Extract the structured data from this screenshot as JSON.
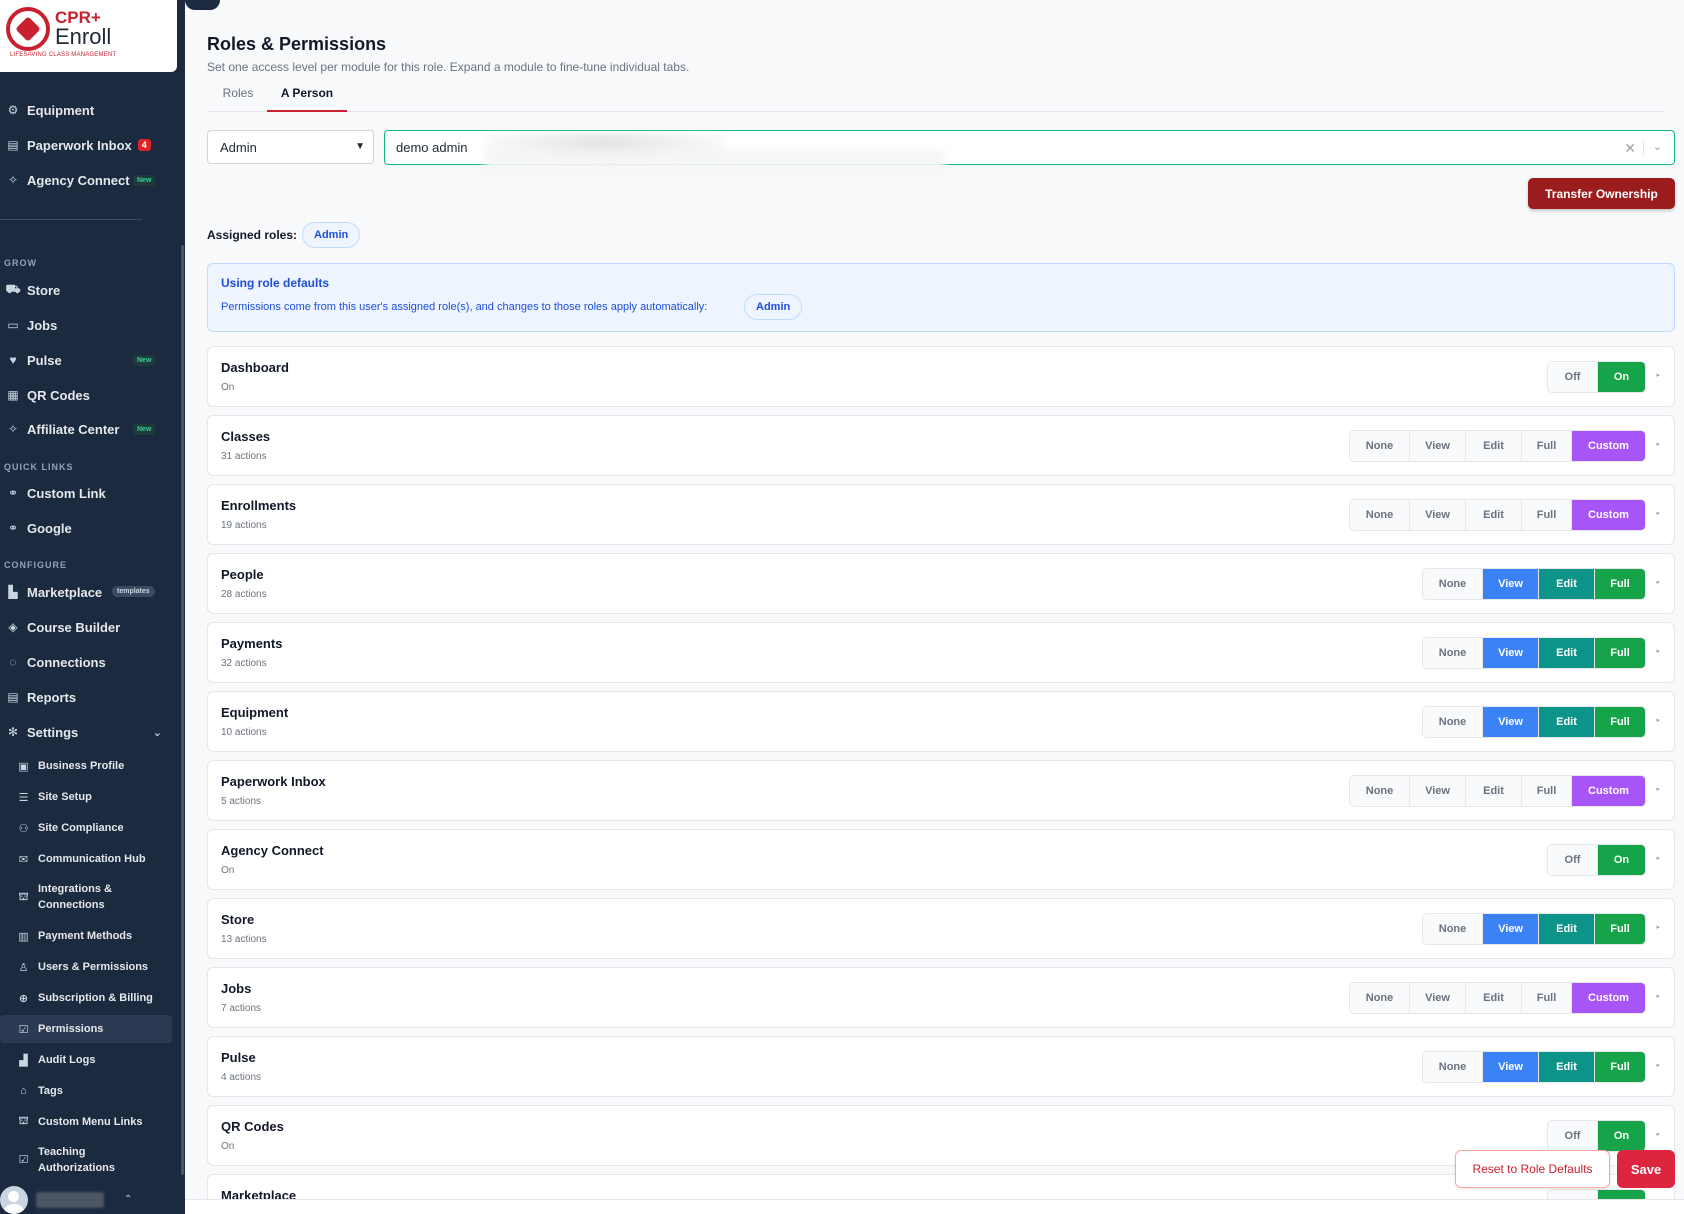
{
  "brand": {
    "name_top": "CPR+",
    "name_bottom": "Enroll",
    "tagline": "LIFESAVING CLASS MANAGEMENT",
    "primary_color": "#c8202f",
    "sidebar_color": "#1b2a3f"
  },
  "sidebar": {
    "top_items": [
      {
        "label": "Equipment",
        "icon": "equipment-icon"
      },
      {
        "label": "Paperwork Inbox",
        "icon": "inbox-icon",
        "badge": "4"
      },
      {
        "label": "Agency Connect",
        "icon": "handshake-icon",
        "badge_new": "New"
      }
    ],
    "sections": {
      "grow": "GROW",
      "quick_links": "QUICK LINKS",
      "configure": "CONFIGURE"
    },
    "grow_items": [
      {
        "label": "Store",
        "icon": "cart-icon"
      },
      {
        "label": "Jobs",
        "icon": "briefcase-icon"
      },
      {
        "label": "Pulse",
        "icon": "heart-icon",
        "badge_new": "New"
      },
      {
        "label": "QR Codes",
        "icon": "qr-icon"
      },
      {
        "label": "Affiliate Center",
        "icon": "handshake-icon",
        "badge_new": "New"
      }
    ],
    "quick_links": [
      {
        "label": "Custom Link",
        "icon": "link-icon"
      },
      {
        "label": "Google",
        "icon": "link-icon"
      }
    ],
    "configure_items": [
      {
        "label": "Marketplace",
        "icon": "store-icon",
        "badge_tpl": "templates"
      },
      {
        "label": "Course Builder",
        "icon": "graduation-icon"
      },
      {
        "label": "Connections",
        "icon": "plug-icon"
      },
      {
        "label": "Reports",
        "icon": "report-icon"
      },
      {
        "label": "Settings",
        "icon": "gear-icon"
      }
    ],
    "settings_items": [
      {
        "label": "Business Profile",
        "icon": "id-card-icon"
      },
      {
        "label": "Site Setup",
        "icon": "sliders-icon"
      },
      {
        "label": "Site Compliance",
        "icon": "users-icon"
      },
      {
        "label": "Communication Hub",
        "icon": "mail-icon"
      },
      {
        "label": "Integrations & Connections",
        "icon": "sitemap-icon"
      },
      {
        "label": "Payment Methods",
        "icon": "receipt-icon"
      },
      {
        "label": "Users & Permissions",
        "icon": "user-icon"
      },
      {
        "label": "Subscription & Billing",
        "icon": "search-dollar-icon"
      },
      {
        "label": "Permissions",
        "icon": "clipboard-check-icon",
        "active": true
      },
      {
        "label": "Audit Logs",
        "icon": "chart-icon"
      },
      {
        "label": "Tags",
        "icon": "tag-icon"
      },
      {
        "label": "Custom Menu Links",
        "icon": "sitemap-icon"
      },
      {
        "label": "Teaching Authorizations",
        "icon": "clipboard-check-icon"
      }
    ]
  },
  "header": {
    "title": "Roles & Permissions",
    "subtitle": "Set one access level per module for this role. Expand a module to fine-tune individual tabs."
  },
  "tabs": [
    {
      "label": "Roles",
      "active": false
    },
    {
      "label": "A Person",
      "active": true
    }
  ],
  "filters": {
    "role_value": "Admin",
    "person_value": "demo admin"
  },
  "actions": {
    "transfer_ownership": "Transfer Ownership",
    "reset": "Reset to Role Defaults",
    "save": "Save"
  },
  "assigned": {
    "label": "Assigned roles:",
    "roles": [
      "Admin"
    ]
  },
  "info": {
    "title": "Using role defaults",
    "text": "Permissions come from this user's assigned role(s), and changes to those roles apply automatically:",
    "role": "Admin"
  },
  "modules": [
    {
      "name": "Dashboard",
      "sub": "On",
      "type": "toggle",
      "options": [
        "Off",
        "On"
      ],
      "selected": "On"
    },
    {
      "name": "Classes",
      "sub": "31 actions",
      "type": "custom",
      "options": [
        "None",
        "View",
        "Edit",
        "Full",
        "Custom"
      ],
      "selected": "Custom"
    },
    {
      "name": "Enrollments",
      "sub": "19 actions",
      "type": "custom",
      "options": [
        "None",
        "View",
        "Edit",
        "Full",
        "Custom"
      ],
      "selected": "Custom"
    },
    {
      "name": "People",
      "sub": "28 actions",
      "type": "level",
      "options": [
        "None",
        "View",
        "Edit",
        "Full"
      ],
      "selected": "Full"
    },
    {
      "name": "Payments",
      "sub": "32 actions",
      "type": "level",
      "options": [
        "None",
        "View",
        "Edit",
        "Full"
      ],
      "selected": "Full"
    },
    {
      "name": "Equipment",
      "sub": "10 actions",
      "type": "level",
      "options": [
        "None",
        "View",
        "Edit",
        "Full"
      ],
      "selected": "Full"
    },
    {
      "name": "Paperwork Inbox",
      "sub": "5 actions",
      "type": "custom",
      "options": [
        "None",
        "View",
        "Edit",
        "Full",
        "Custom"
      ],
      "selected": "Custom"
    },
    {
      "name": "Agency Connect",
      "sub": "On",
      "type": "toggle",
      "options": [
        "Off",
        "On"
      ],
      "selected": "On"
    },
    {
      "name": "Store",
      "sub": "13 actions",
      "type": "level",
      "options": [
        "None",
        "View",
        "Edit",
        "Full"
      ],
      "selected": "Full"
    },
    {
      "name": "Jobs",
      "sub": "7 actions",
      "type": "custom",
      "options": [
        "None",
        "View",
        "Edit",
        "Full",
        "Custom"
      ],
      "selected": "Custom"
    },
    {
      "name": "Pulse",
      "sub": "4 actions",
      "type": "level",
      "options": [
        "None",
        "View",
        "Edit",
        "Full"
      ],
      "selected": "Full"
    },
    {
      "name": "QR Codes",
      "sub": "On",
      "type": "toggle",
      "options": [
        "Off",
        "On"
      ],
      "selected": "On"
    },
    {
      "name": "Marketplace",
      "sub": "",
      "type": "toggle",
      "options": [
        "Off",
        "On"
      ],
      "selected": "On"
    }
  ]
}
